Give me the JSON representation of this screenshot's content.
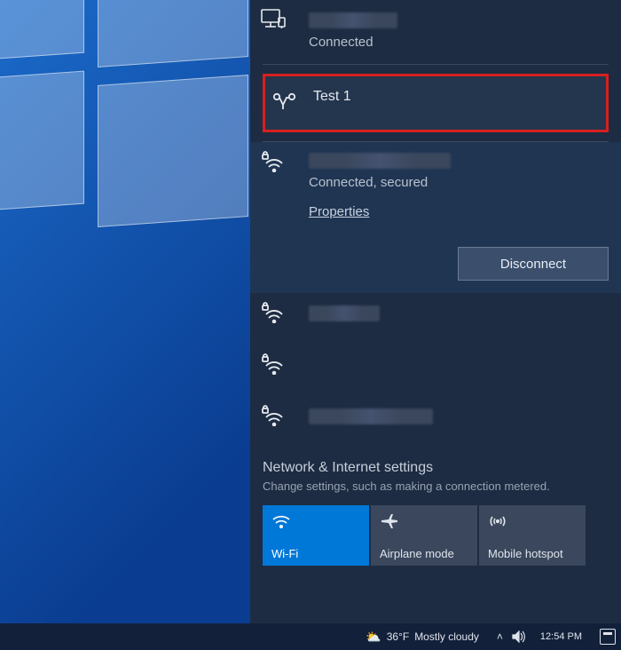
{
  "networks": {
    "ethernet": {
      "status_text": "Connected"
    },
    "vpn": {
      "name": "Test 1"
    },
    "wifi_selected": {
      "status_text": "Connected, secured",
      "properties_label": "Properties",
      "disconnect_label": "Disconnect"
    }
  },
  "settings": {
    "title": "Network & Internet settings",
    "subtitle": "Change settings, such as making a connection metered."
  },
  "tiles": {
    "wifi": "Wi-Fi",
    "airplane": "Airplane mode",
    "hotspot": "Mobile hotspot"
  },
  "taskbar": {
    "weather_temp": "36°F",
    "weather_text": "Mostly cloudy",
    "time": "12:54 PM"
  }
}
